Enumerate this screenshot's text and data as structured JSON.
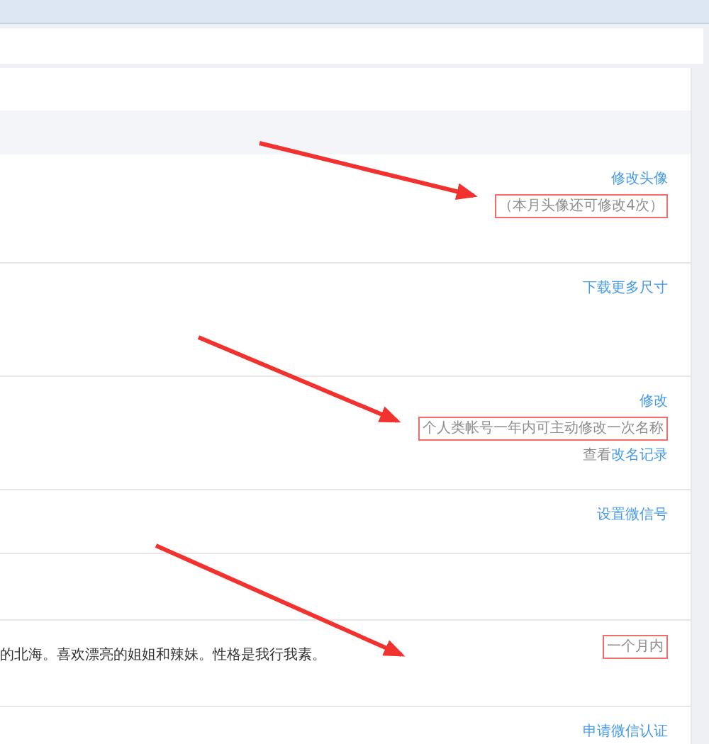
{
  "rows": [
    {
      "kind": "header"
    },
    {
      "kind": "setting",
      "text": "",
      "actions": [
        {
          "kind": "link",
          "text": "修改头像"
        },
        {
          "kind": "note",
          "text": "（本月头像还可修改4次）",
          "boxed": true
        }
      ]
    },
    {
      "kind": "setting",
      "text": "",
      "actions": [
        {
          "kind": "link",
          "text": "下载更多尺寸"
        }
      ]
    },
    {
      "kind": "setting",
      "text": "",
      "actions": [
        {
          "kind": "link",
          "text": "修改"
        },
        {
          "kind": "note",
          "text": "个人类帐号一年内可主动修改一次名称",
          "boxed": true
        },
        {
          "kind": "mixed",
          "parts": [
            {
              "kind": "note",
              "text": "查看"
            },
            {
              "kind": "link",
              "text": "改名记录"
            }
          ]
        }
      ]
    },
    {
      "kind": "setting",
      "text": "",
      "actions": [
        {
          "kind": "link",
          "text": "设置微信号"
        }
      ]
    },
    {
      "kind": "setting",
      "text": "",
      "actions": []
    },
    {
      "kind": "setting",
      "text": "的北海。喜欢漂亮的姐姐和辣妹。性格是我行我素。",
      "actions": [
        {
          "kind": "note",
          "text": "一个月内",
          "boxed": true
        }
      ]
    },
    {
      "kind": "setting",
      "text": "",
      "actions": [
        {
          "kind": "link",
          "text": "申请微信认证"
        }
      ]
    }
  ]
}
